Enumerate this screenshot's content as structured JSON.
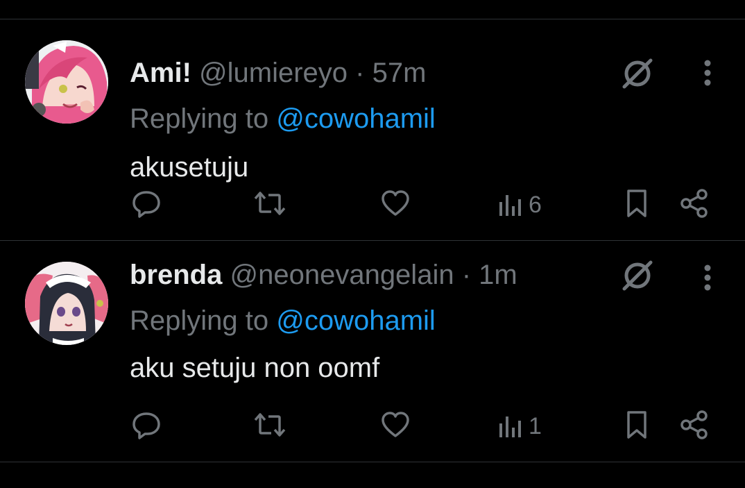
{
  "tweets": [
    {
      "display_name": "Ami!",
      "handle": "@lumiereyo",
      "separator": "·",
      "time": "57m",
      "replying_to_label": "Replying to",
      "replying_to_handle": "@cowohamil",
      "text": "akusetuju",
      "views": "6"
    },
    {
      "display_name": "brenda",
      "handle": "@neonevangelain",
      "separator": "·",
      "time": "1m",
      "replying_to_label": "Replying to",
      "replying_to_handle": "@cowohamil",
      "text": "aku setuju non oomf",
      "views": "1"
    }
  ],
  "icons": {
    "grok": "grok-icon",
    "more": "more-vertical-icon",
    "reply": "reply-icon",
    "retweet": "retweet-icon",
    "like": "heart-icon",
    "views": "views-chart-icon",
    "bookmark": "bookmark-icon",
    "share": "share-icon"
  },
  "colors": {
    "background": "#000000",
    "primary_text": "#e7e9ea",
    "secondary_text": "#71767b",
    "mention": "#1d9bf0",
    "divider": "#2f3336"
  }
}
